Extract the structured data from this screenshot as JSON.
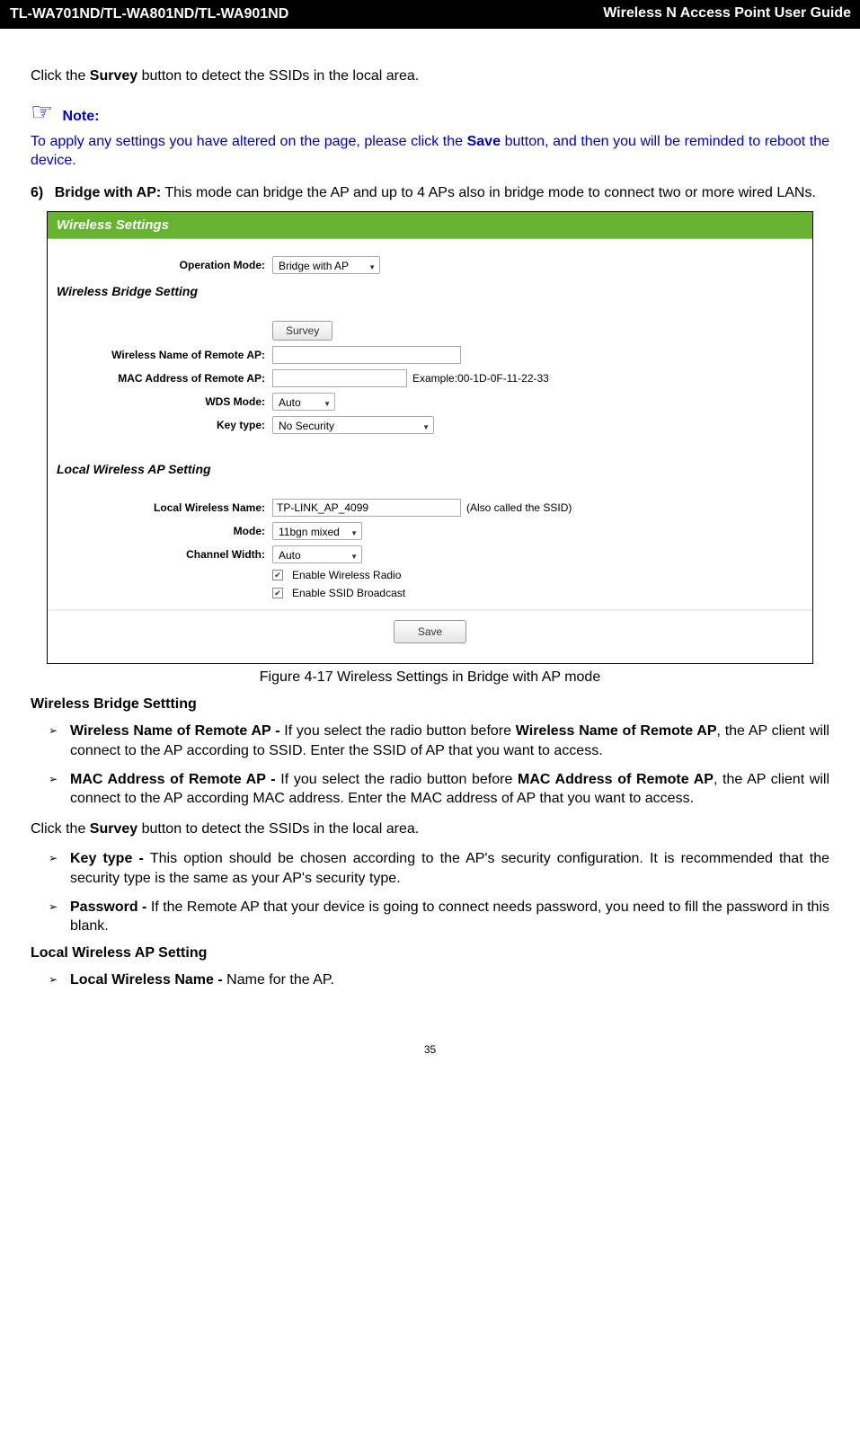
{
  "header": {
    "models": "TL-WA701ND/TL-WA801ND/TL-WA901ND",
    "guide": "Wireless N Access Point User Guide"
  },
  "intro": {
    "survey_line_prefix": "Click the ",
    "survey_bold": "Survey",
    "survey_line_suffix": " button to detect the SSIDs in the local area."
  },
  "note": {
    "icon": "☞",
    "label": " Note:",
    "text_prefix": "To apply any settings you have altered on the page, please click the ",
    "save_bold": "Save",
    "text_suffix": " button, and then you will be reminded to reboot the device."
  },
  "item6": {
    "num": "6)",
    "title": "Bridge with AP:",
    "desc": " This mode can bridge the AP and up to 4 APs also in bridge mode to connect two or more wired LANs."
  },
  "figure": {
    "panel_title": "Wireless Settings",
    "operation_mode_label": "Operation Mode:",
    "operation_mode_value": "Bridge with AP",
    "bridge_heading": "Wireless Bridge Setting",
    "survey_btn": "Survey",
    "remote_name_label": "Wireless Name of Remote AP:",
    "remote_name_value": "",
    "remote_mac_label": "MAC Address of Remote AP:",
    "remote_mac_value": "",
    "mac_example": "Example:00-1D-0F-11-22-33",
    "wds_label": "WDS Mode:",
    "wds_value": "Auto",
    "key_label": "Key type:",
    "key_value": "No Security",
    "local_heading": "Local Wireless AP Setting",
    "local_name_label": "Local Wireless Name:",
    "local_name_value": "TP-LINK_AP_4099",
    "ssid_hint": "(Also called the SSID)",
    "mode_label": "Mode:",
    "mode_value": "11bgn mixed",
    "chw_label": "Channel Width:",
    "chw_value": "Auto",
    "cb1": "Enable Wireless Radio",
    "cb2": "Enable SSID Broadcast",
    "save_btn": "Save",
    "caption": "Figure 4-17 Wireless Settings in Bridge with AP mode"
  },
  "sections": {
    "bridge_heading": "Wireless Bridge Settting",
    "b1_title": "Wireless Name of Remote AP - ",
    "b1_text_a": "If you select the radio button before ",
    "b1_bold": "Wireless Name of Remote AP",
    "b1_text_b": ", the AP client will connect to the AP according to SSID. Enter the SSID of AP that you want to access.",
    "b2_title": "MAC Address of Remote AP - ",
    "b2_text_a": "If you select the radio button before ",
    "b2_bold": "MAC Address of Remote AP",
    "b2_text_b": ", the AP client will connect to the AP according MAC address. Enter the MAC address of AP that you want to access.",
    "survey2_prefix": "Click the ",
    "survey2_bold": "Survey",
    "survey2_suffix": " button to detect the SSIDs in the local area.",
    "b3_title": "Key type - ",
    "b3_text": "This option should be chosen according to the AP's security configuration. It is recommended that the security type is the same as your AP's security type.",
    "b4_title": "Password - ",
    "b4_text": "If the Remote AP that your device is going to connect needs password, you need to fill the password in this blank.",
    "local_heading": "Local Wireless AP Setting",
    "l1_title": "Local Wireless Name - ",
    "l1_text": "Name for the AP."
  },
  "footer": {
    "page": "35"
  }
}
